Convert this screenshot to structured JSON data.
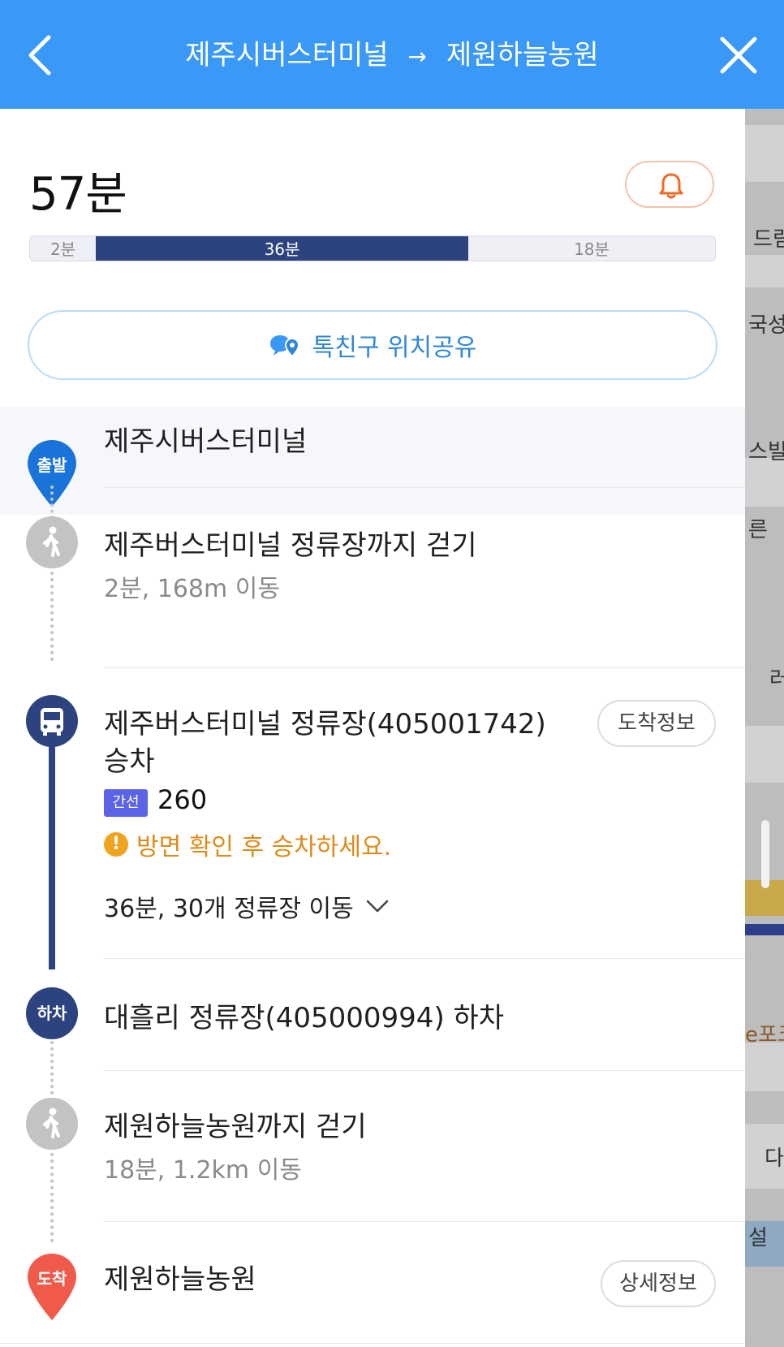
{
  "header": {
    "origin": "제주시버스터미널",
    "arrow": "→",
    "destination": "제원하늘농원",
    "bg_color": "#3a98f6"
  },
  "summary": {
    "total_time": "57분",
    "segments": [
      {
        "label": "2분",
        "minutes": 2,
        "mode": "walk"
      },
      {
        "label": "36분",
        "minutes": 36,
        "mode": "bus"
      },
      {
        "label": "18분",
        "minutes": 18,
        "mode": "walk"
      }
    ],
    "share_label": "톡친구 위치공유"
  },
  "steps": {
    "start": {
      "marker": "출발",
      "title": "제주시버스터미널"
    },
    "walk1": {
      "title": "제주버스터미널 정류장까지 걷기",
      "sub": "2분, 168m 이동"
    },
    "board": {
      "title_line1": "제주버스터미널 정류장(405001742)",
      "title_line2": "승차",
      "arrival_button": "도착정보",
      "route_type": "간선",
      "route_number": "260",
      "warning": "방면 확인 후 승차하세요.",
      "ride_info": "36분, 30개 정류장 이동"
    },
    "alight": {
      "marker": "하차",
      "title": "대흘리 정류장(405000994) 하차"
    },
    "walk2": {
      "title": "제원하늘농원까지 걷기",
      "sub": "18분, 1.2km 이동"
    },
    "end": {
      "marker": "도착",
      "title": "제원하늘농원",
      "detail_button": "상세정보"
    }
  },
  "map": {
    "labels": [
      "드림",
      "국성",
      "스빌",
      "른",
      "러",
      "e포크",
      "다",
      "설"
    ]
  },
  "colors": {
    "bus_line": "#2d437f",
    "route_badge": "#5c63e6",
    "warning": "#e08a1a",
    "start_pin": "#1a73d9",
    "end_pin": "#f05a4b"
  }
}
